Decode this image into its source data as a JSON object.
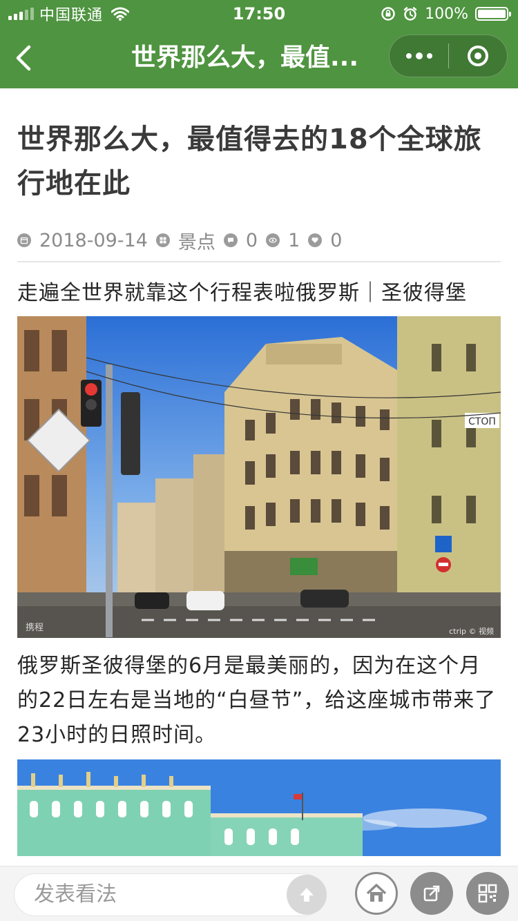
{
  "status_bar": {
    "carrier": "中国联通",
    "time": "17:50",
    "battery_percent": "100%",
    "battery_level": 1.0
  },
  "nav": {
    "title": "世界那么大，最值..."
  },
  "article": {
    "title": "世界那么大，最值得去的18个全球旅行地在此",
    "meta": {
      "date": "2018-09-14",
      "category": "景点",
      "comments": "0",
      "views": "1",
      "likes": "0"
    },
    "paragraph1": "走遍全世界就靠这个行程表啦俄罗斯｜圣彼得堡",
    "paragraph2": "俄罗斯圣彼得堡的6月是最美丽的，因为在这个月的22日左右是当地的“白昼节”，给这座城市带来了23小时的日照时间。",
    "photo1_watermark_left": "携程",
    "photo1_watermark_right": "ctrip © 视频",
    "photo1_sign": "СТОП"
  },
  "bottom_bar": {
    "comment_placeholder": "发表看法"
  },
  "colors": {
    "brand_green": "#4f9440",
    "bar_gray": "#8c8c8c"
  },
  "icons": [
    "signal-icon",
    "wifi-icon",
    "lock-rotation-icon",
    "alarm-icon",
    "battery-icon",
    "back-icon",
    "more-icon",
    "close-icon",
    "calendar-icon",
    "category-icon",
    "comment-icon",
    "eye-icon",
    "heart-icon",
    "send-icon",
    "home-icon",
    "share-icon",
    "qr-code-icon"
  ]
}
